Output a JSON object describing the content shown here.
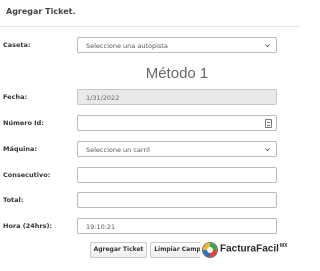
{
  "header": {
    "title": "Agregar Ticket."
  },
  "form": {
    "caseta": {
      "label": "Caseta:",
      "value": "Seleccione una autopista"
    },
    "method_title": "Método 1",
    "fecha": {
      "label": "Fecha:",
      "value": "1/31/2022"
    },
    "numero_id": {
      "label": "Número Id:",
      "value": ""
    },
    "maquina": {
      "label": "Máquina:",
      "value": "Seleccione un carril"
    },
    "consecutivo": {
      "label": "Consecutivo:",
      "value": ""
    },
    "total": {
      "label": "Total:",
      "value": ""
    },
    "hora": {
      "label": "Hora (24hrs):",
      "value": "19:10:21"
    }
  },
  "buttons": {
    "add": "Agregar Ticket",
    "clear": "Limpiar Camp"
  },
  "logo": {
    "text": "FacturaFacil",
    "suffix": "MX"
  },
  "icons": {
    "select": "chevron-down-icon",
    "number": "spinner-icon",
    "logo": "factura-logo-icon"
  }
}
